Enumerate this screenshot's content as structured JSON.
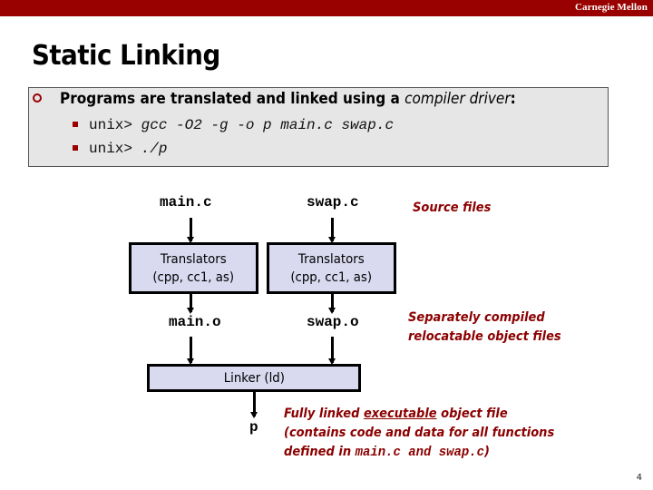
{
  "header": {
    "brand": "Carnegie Mellon",
    "bar_color": "#990000"
  },
  "slide": {
    "title": "Static Linking",
    "page_number": "4"
  },
  "intro": {
    "text_before": "Programs are translated and linked using a ",
    "text_italic": "compiler driver",
    "text_after": ":",
    "commands": [
      {
        "prompt": "unix> ",
        "command": "gcc -O2 -g -o p main.c swap.c"
      },
      {
        "prompt": "unix> ",
        "command": "./p"
      }
    ]
  },
  "diagram": {
    "sources": [
      "main.c",
      "swap.c"
    ],
    "translators": [
      {
        "line1": "Translators",
        "line2": "(cpp, cc1, as)"
      },
      {
        "line1": "Translators",
        "line2": "(cpp, cc1, as)"
      }
    ],
    "objects": [
      "main.o",
      "swap.o"
    ],
    "linker": "Linker (ld)",
    "output": "p",
    "notes": {
      "source": "Source files",
      "object_line1": "Separately compiled",
      "object_line2": "relocatable object files",
      "exe_line1_before": "Fully linked ",
      "exe_line1_underlined": "executable",
      "exe_line1_after": " object file",
      "exe_line2": "(contains code and data for all functions",
      "exe_line3_before": "defined in ",
      "exe_line3_code": "main.c and swap.c",
      "exe_line3_after": ")"
    },
    "note_color": "#8b0000",
    "box_fill": "#d9d9f0"
  }
}
